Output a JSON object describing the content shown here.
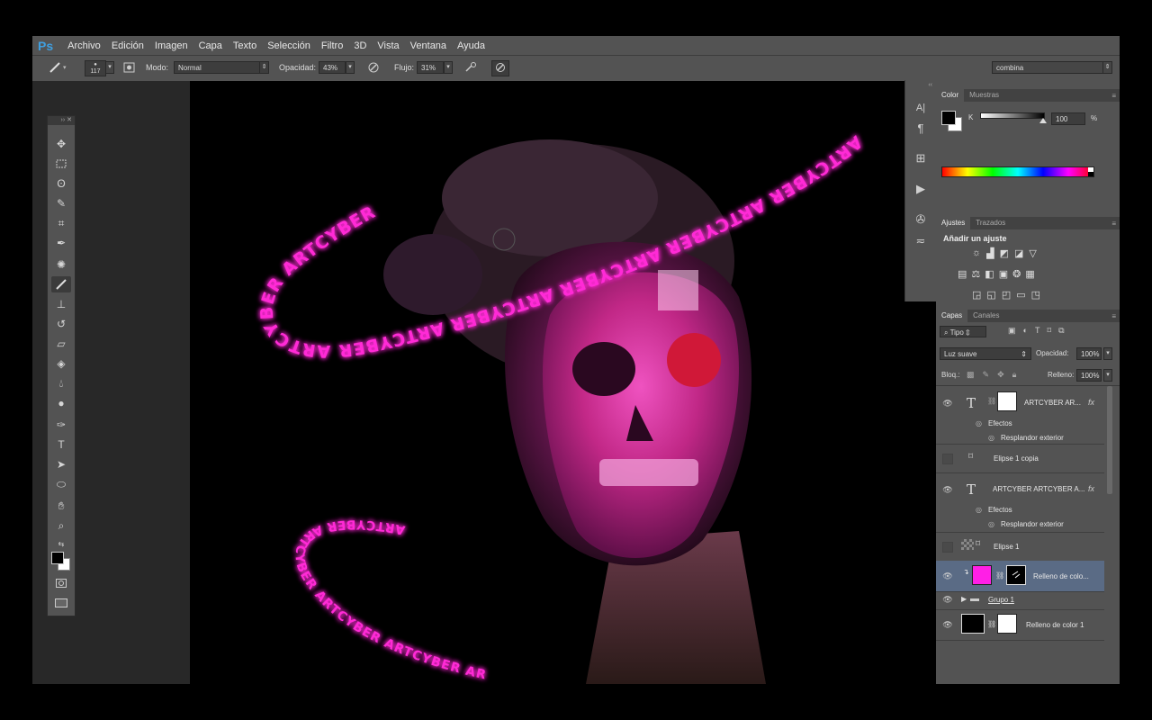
{
  "app": {
    "logo": "Ps"
  },
  "menu": [
    "Archivo",
    "Edición",
    "Imagen",
    "Capa",
    "Texto",
    "Selección",
    "Filtro",
    "3D",
    "Vista",
    "Ventana",
    "Ayuda"
  ],
  "options": {
    "brush_size": "117",
    "mode_label": "Modo:",
    "mode_value": "Normal",
    "opacity_label": "Opacidad:",
    "opacity_value": "43%",
    "flow_label": "Flujo:",
    "flow_value": "31%",
    "workspace_value": "combina"
  },
  "canvas": {
    "ring_text": "ARTCYBER ARTCYBER ARTCYBER ARTCYBER ARTCYBER ARTCYBER ARTCYBER",
    "neon_color": "#ff2bd6"
  },
  "color_panel": {
    "tabs": [
      "Color",
      "Muestras"
    ],
    "channel_label": "K",
    "value": "100",
    "unit": "%"
  },
  "adjustments_panel": {
    "tabs": [
      "Ajustes",
      "Trazados"
    ],
    "title": "Añadir un ajuste"
  },
  "layers_panel": {
    "tabs": [
      "Capas",
      "Canales"
    ],
    "filter_label": "Tipo",
    "blend_mode": "Luz suave",
    "opacity_label": "Opacidad:",
    "opacity_value": "100%",
    "lock_label": "Bloq.:",
    "fill_label": "Relleno:",
    "fill_value": "100%",
    "layers": {
      "text_top": {
        "name": "ARTCYBER AR...",
        "effects": "Efectos",
        "effect": "Resplandor exterior"
      },
      "ellipse_copy": {
        "name": "Elipse 1 copia"
      },
      "text_second": {
        "name": "ARTCYBER ARTCYBER A...",
        "effects": "Efectos",
        "effect": "Resplandor exterior"
      },
      "ellipse": {
        "name": "Elipse 1"
      },
      "fill_magenta": {
        "name": "Relleno de colo...",
        "color": "#ff1fe6"
      },
      "group": {
        "name": "Grupo 1"
      },
      "fill_black": {
        "name": "Relleno de color 1",
        "color": "#000000"
      }
    }
  }
}
